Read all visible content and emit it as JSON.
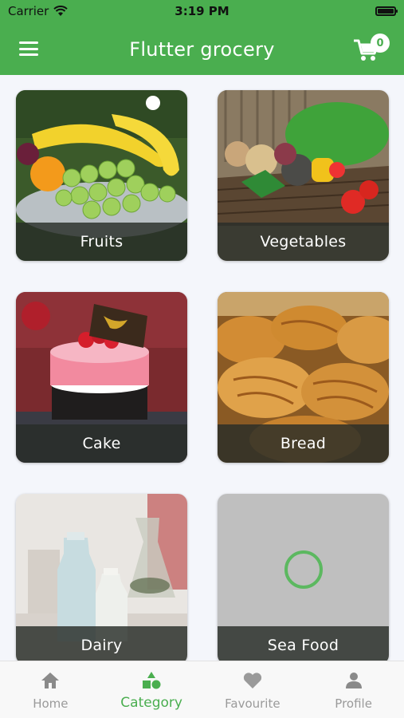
{
  "status_bar": {
    "carrier": "Carrier",
    "time": "3:19 PM"
  },
  "app_bar": {
    "title": "Flutter grocery",
    "cart_count": "0"
  },
  "categories": [
    {
      "label": "Fruits",
      "image": "fruits-photo"
    },
    {
      "label": "Vegetables",
      "image": "vegetables-photo"
    },
    {
      "label": "Cake",
      "image": "cake-photo"
    },
    {
      "label": "Bread",
      "image": "bread-photo"
    },
    {
      "label": "Dairy",
      "image": "dairy-photo"
    },
    {
      "label": "Sea Food",
      "image": "loading-placeholder"
    }
  ],
  "bottom_nav": {
    "items": [
      {
        "label": "Home",
        "icon": "home-icon",
        "active": false
      },
      {
        "label": "Category",
        "icon": "category-icon",
        "active": true
      },
      {
        "label": "Favourite",
        "icon": "heart-icon",
        "active": false
      },
      {
        "label": "Profile",
        "icon": "person-icon",
        "active": false
      }
    ]
  },
  "colors": {
    "primary": "#4aae4f",
    "background": "#f4f6fb",
    "inactive": "#9a9a9a"
  }
}
